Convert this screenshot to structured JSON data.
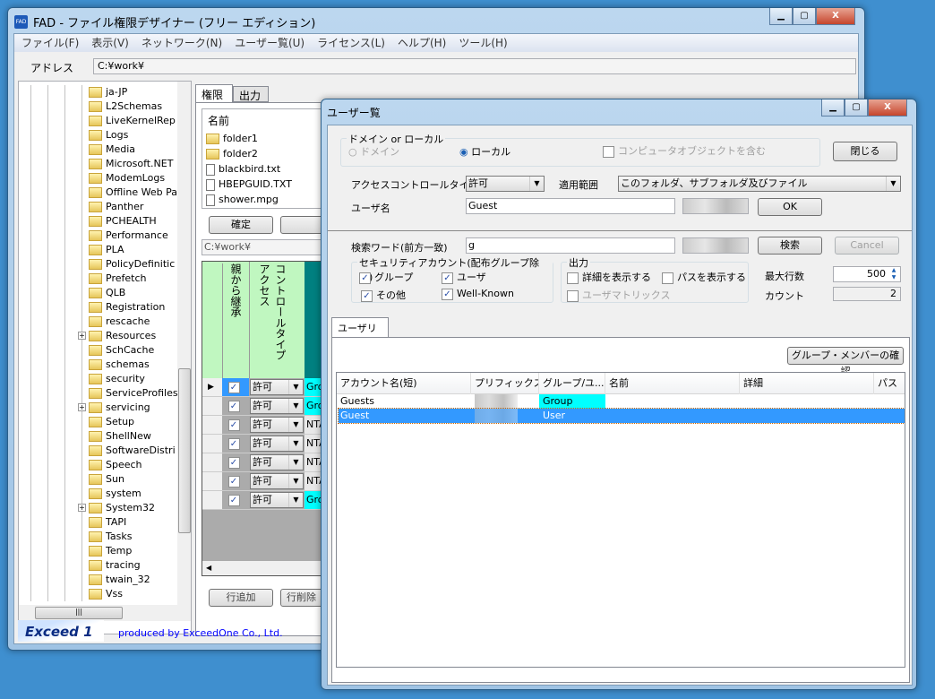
{
  "main": {
    "title": "FAD - ファイル権限デザイナー (フリー エディション)",
    "icon_text": "FAD",
    "menu": [
      "ファイル(F)",
      "表示(V)",
      "ネットワーク(N)",
      "ユーザー覧(U)",
      "ライセンス(L)",
      "ヘルプ(H)",
      "ツール(H)"
    ],
    "address_label": "アドレス",
    "address_value": "C:¥work¥",
    "tree": [
      "ja-JP",
      "L2Schemas",
      "LiveKernelRep",
      "Logs",
      "Media",
      "Microsoft.NET",
      "ModemLogs",
      "Offline Web Pa",
      "Panther",
      "PCHEALTH",
      "Performance",
      "PLA",
      "PolicyDefinitic",
      "Prefetch",
      "QLB",
      "Registration",
      "rescache",
      "Resources",
      "SchCache",
      "schemas",
      "security",
      "ServiceProfiles",
      "servicing",
      "Setup",
      "ShellNew",
      "SoftwareDistri",
      "Speech",
      "Sun",
      "system",
      "System32",
      "TAPI",
      "Tasks",
      "Temp",
      "tracing",
      "twain_32",
      "Vss"
    ],
    "tabs": [
      "権限",
      "出力"
    ],
    "file_header": "名前",
    "files": [
      "folder1",
      "folder2",
      "blackbird.txt",
      "HBEPGUID.TXT",
      "shower.mpg"
    ],
    "confirm_button": "確定",
    "path_value": "C:¥work¥",
    "grid_headers": [
      "親から継承",
      "コントロールタイプ",
      "アクセス"
    ],
    "grid_rows": [
      {
        "type": "許可",
        "acct": "Grou",
        "cyan": true
      },
      {
        "type": "許可",
        "acct": "Grou",
        "cyan": true
      },
      {
        "type": "許可",
        "acct": "NTA",
        "cyan": false
      },
      {
        "type": "許可",
        "acct": "NTA",
        "cyan": false
      },
      {
        "type": "許可",
        "acct": "NTA",
        "cyan": false
      },
      {
        "type": "許可",
        "acct": "NTA",
        "cyan": false
      },
      {
        "type": "許可",
        "acct": "Grou",
        "cyan": true
      }
    ],
    "add_row_button": "行追加",
    "delete_row_button": "行削除",
    "logo_text": "Exceed 1",
    "link": "produced by ExceedOne Co., Ltd."
  },
  "dialog": {
    "title": "ユーザー覧",
    "domain_group": "ドメイン or ローカル",
    "radio_domain": "ドメイン",
    "radio_local": "ローカル",
    "include_computer": "コンピュータオブジェクトを含む",
    "close_button": "閉じる",
    "act_label": "アクセスコントロールタイプ",
    "act_value": "許可",
    "scope_label": "適用範囲",
    "scope_value": "このフォルダ、サブフォルダ及びファイル",
    "user_label": "ユーザ名",
    "user_value": "Guest",
    "ok_button": "OK",
    "search_label": "検索ワード(前方一致)",
    "search_value": "g",
    "search_button": "検索",
    "cancel_button": "Cancel",
    "sec_group": "セキュリティアカウント(配布グループ除く)",
    "cb_group": "グループ",
    "cb_user": "ユーザ",
    "cb_other": "その他",
    "cb_wellknown": "Well-Known",
    "out_group": "出力",
    "cb_detail": "詳細を表示する",
    "cb_path": "パスを表示する",
    "cb_matrix": "ユーザマトリックス",
    "max_rows_label": "最大行数",
    "max_rows_value": "500",
    "count_label": "カウント",
    "count_value": "2",
    "tab_userlist": "ユーザリスト",
    "member_button": "グループ・メンバーの確認",
    "columns": [
      "アカウント名(短)",
      "プリフィックス...",
      "グループ/ユ...",
      "名前",
      "詳細",
      "パス"
    ],
    "rows": [
      {
        "account": "Guests",
        "kind": "Group",
        "selected": false
      },
      {
        "account": "Guest",
        "kind": "User",
        "selected": true
      }
    ],
    "colors": {
      "selection": "#3399ff",
      "group_cell": "#00ffff"
    }
  }
}
